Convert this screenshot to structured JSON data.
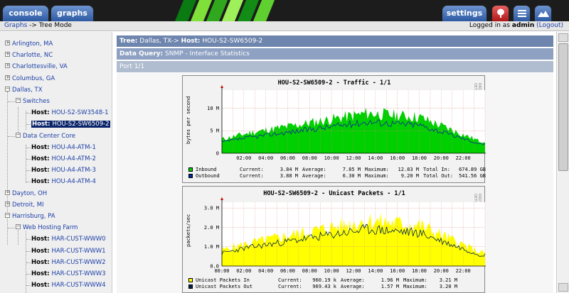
{
  "tabs": {
    "console": "console",
    "graphs": "graphs",
    "settings": "settings"
  },
  "icons": {
    "tree": "tree-icon",
    "list": "list-icon",
    "preview": "mountain-icon"
  },
  "breadcrumb": {
    "link": "Graphs",
    "rest": "-> Tree Mode"
  },
  "login": {
    "prefix": "Logged in as",
    "user": "admin",
    "logout": "(Logout)"
  },
  "tree": [
    {
      "label": "Arlington, MA",
      "type": "site"
    },
    {
      "label": "Charlotte, NC",
      "type": "site"
    },
    {
      "label": "Charlottesville, VA",
      "type": "site"
    },
    {
      "label": "Columbus, GA",
      "type": "site"
    },
    {
      "label": "Dallas, TX",
      "type": "site",
      "open": true
    },
    {
      "label": "Switches",
      "type": "group"
    },
    {
      "prefix": "Host:",
      "label": "HOU-S2-SW3548-1",
      "type": "host"
    },
    {
      "prefix": "Host:",
      "label": "HOU-S2-SW6509-2",
      "type": "host",
      "selected": true
    },
    {
      "label": "Data Center Core",
      "type": "group"
    },
    {
      "prefix": "Host:",
      "label": "HOU-A4-ATM-1",
      "type": "host"
    },
    {
      "prefix": "Host:",
      "label": "HOU-A4-ATM-2",
      "type": "host"
    },
    {
      "prefix": "Host:",
      "label": "HOU-A4-ATM-3",
      "type": "host"
    },
    {
      "prefix": "Host:",
      "label": "HOU-A4-ATM-4",
      "type": "host"
    },
    {
      "label": "Dayton, OH",
      "type": "site"
    },
    {
      "label": "Detroit, MI",
      "type": "site"
    },
    {
      "label": "Harrisburg, PA",
      "type": "site",
      "open": true
    },
    {
      "label": "Web Hosting Farm",
      "type": "group"
    },
    {
      "prefix": "Host:",
      "label": "HAR-CUST-WWW0",
      "type": "host"
    },
    {
      "prefix": "Host:",
      "label": "HAR-CUST-WWW1",
      "type": "host"
    },
    {
      "prefix": "Host:",
      "label": "HAR-CUST-WWW2",
      "type": "host"
    },
    {
      "prefix": "Host:",
      "label": "HAR-CUST-WWW3",
      "type": "host"
    },
    {
      "prefix": "Host:",
      "label": "HAR-CUST-WWW4",
      "type": "host"
    }
  ],
  "header": {
    "tree_label": "Tree:",
    "tree_value": "Dallas, TX->",
    "host_label": "Host:",
    "host_value": "HOU-S2-SW6509-2",
    "dq_label": "Data Query:",
    "dq_value": "SNMP - Interface Statistics",
    "port": "Port 1/1"
  },
  "graphs": {
    "side_text": "RRDTOOL / TOBI OETIKER",
    "traffic": {
      "title": "HOU-S2-SW6509-2 - Traffic - 1/1",
      "ylabel": "bytes per second",
      "yticks": [
        "10 M",
        "5 M",
        "0"
      ],
      "xticks": [
        "02:00",
        "04:00",
        "06:00",
        "08:00",
        "10:00",
        "12:00",
        "14:00",
        "16:00",
        "18:00",
        "20:00",
        "22:00"
      ],
      "legend": [
        {
          "name": "Inbound",
          "current": "3.84 M",
          "average": "7.85 M",
          "maximum": "12.83 M",
          "total_label": "Total In:",
          "total": "674.89 GB",
          "color": "#00cf00"
        },
        {
          "name": "Outbound",
          "current": "3.88 M",
          "average": "6.30 M",
          "maximum": "9.20 M",
          "total_label": "Total Out:",
          "total": "541.56 GB",
          "color": "#002a97"
        }
      ]
    },
    "unicast": {
      "title": "HOU-S2-SW6509-2 - Unicast Packets - 1/1",
      "ylabel": "packets/sec",
      "yticks": [
        "3.0 M",
        "2.0 M",
        "1.0 M",
        "0.0"
      ],
      "xticks": [
        "00:00",
        "02:00",
        "04:00",
        "06:00",
        "08:00",
        "10:00",
        "12:00",
        "14:00",
        "16:00",
        "18:00",
        "20:00",
        "22:00"
      ],
      "legend": [
        {
          "name": "Unicast Packets In",
          "current": "960.19 k",
          "average": "1.96 M",
          "maximum": "3.21 M",
          "color": "#ffff00"
        },
        {
          "name": "Unicast Packets Out",
          "current": "969.43 k",
          "average": "1.57 M",
          "maximum": "3.20 M",
          "color": "#00234b"
        }
      ]
    },
    "labels": {
      "current": "Current:",
      "average": "Average:",
      "maximum": "Maximum:"
    }
  }
}
